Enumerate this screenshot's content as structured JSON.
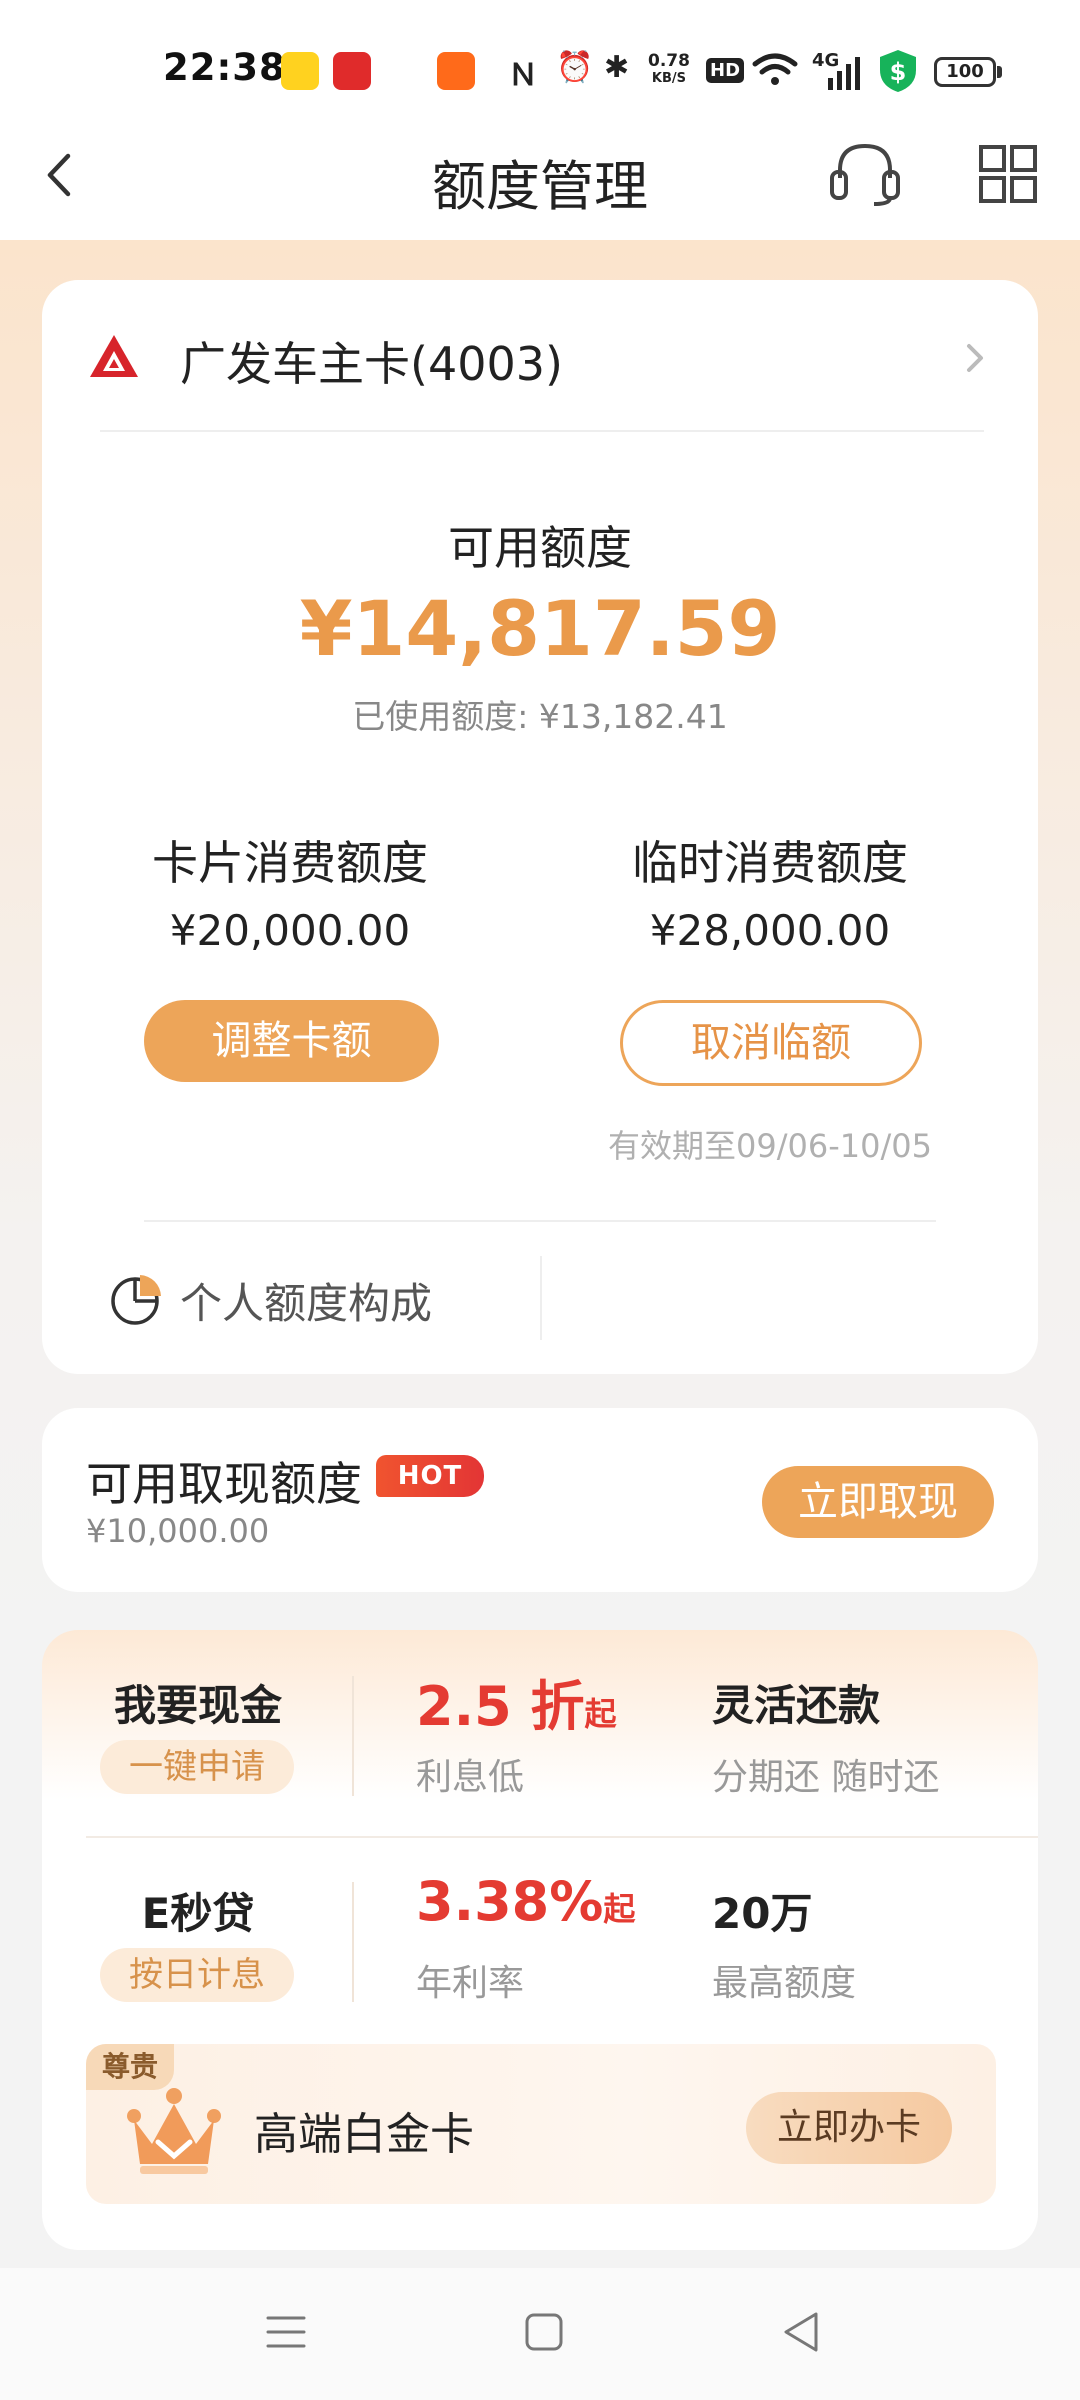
{
  "status_bar": {
    "time": "22:38",
    "net_speed_value": "0.78",
    "net_speed_unit": "KB/S",
    "hd_label": "HD",
    "network_label": "4G",
    "battery": "100"
  },
  "header": {
    "title": "额度管理"
  },
  "card_info": {
    "card_name": "广发车主卡(4003)"
  },
  "credit": {
    "available_label": "可用额度",
    "available_amount": "¥14,817.59",
    "used_text": "已使用额度: ¥13,182.41"
  },
  "limits": {
    "card_limit_label": "卡片消费额度",
    "card_limit_value": "¥20,000.00",
    "adjust_button": "调整卡额",
    "temp_limit_label": "临时消费额度",
    "temp_limit_value": "¥28,000.00",
    "cancel_temp_button": "取消临额",
    "validity": "有效期至09/06-10/05"
  },
  "composition": {
    "label": "个人额度构成"
  },
  "cash": {
    "title": "可用取现额度",
    "badge": "HOT",
    "amount": "¥10,000.00",
    "button": "立即取现"
  },
  "loans": [
    {
      "title": "我要现金",
      "tag": "一键申请",
      "rate_value": "2.5 折",
      "rate_suffix": "起",
      "rate_sub": "利息低",
      "feature_title": "灵活还款",
      "feature_sub": "分期还 随时还"
    },
    {
      "title": "E秒贷",
      "tag": "按日计息",
      "rate_value": "3.38%",
      "rate_suffix": "起",
      "rate_sub": "年利率",
      "feature_title": "20万",
      "feature_sub": "最高额度"
    }
  ],
  "vip": {
    "tag": "尊贵",
    "label": "高端白金卡",
    "button": "立即办卡"
  },
  "colors": {
    "accent": "#eda559",
    "amount": "#ea9a4b",
    "rate_red": "#e43b32"
  }
}
